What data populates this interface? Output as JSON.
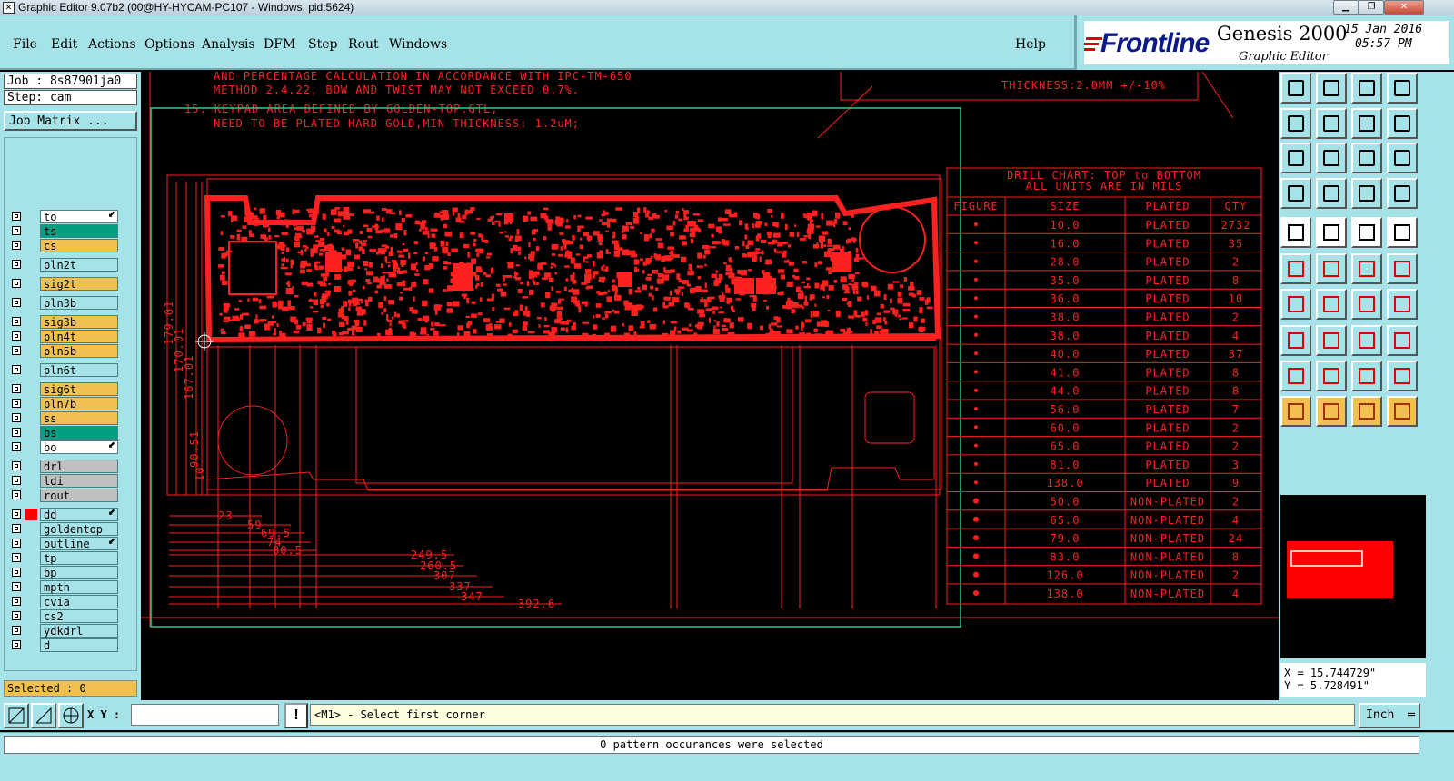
{
  "window": {
    "title": "Graphic Editor 9.07b2 (00@HY-HYCAM-PC107 - Windows, pid:5624)"
  },
  "menu": {
    "items": [
      {
        "label": "File",
        "name": "menu-file"
      },
      {
        "label": "Edit",
        "name": "menu-edit"
      },
      {
        "label": "Actions",
        "name": "menu-actions"
      },
      {
        "label": "Options",
        "name": "menu-options"
      },
      {
        "label": "Analysis",
        "name": "menu-analysis"
      },
      {
        "label": "DFM",
        "name": "menu-dfm"
      },
      {
        "label": "Step",
        "name": "menu-step"
      },
      {
        "label": "Rout",
        "name": "menu-rout"
      },
      {
        "label": "Windows",
        "name": "menu-windows"
      }
    ],
    "help": "Help"
  },
  "logo": {
    "brand": "Frontline",
    "product": "Genesis 2000",
    "subtitle": "Graphic Editor",
    "date": "15 Jan 2016",
    "time": "05:57 PM"
  },
  "job": {
    "job_label": "Job : 8s87901ja0",
    "step_label": "Step: cam",
    "matrix_button": "Job Matrix ..."
  },
  "layers": [
    {
      "name": "to",
      "color": "#ffffff",
      "arrow": true
    },
    {
      "name": "ts",
      "color": "#00a080"
    },
    {
      "name": "cs",
      "color": "#f0c050"
    },
    {
      "name": "pln2t",
      "color": "#a6e3e8",
      "gap": true
    },
    {
      "name": "sig2t",
      "color": "#f0c050",
      "gap": true
    },
    {
      "name": "pln3b",
      "color": "#a6e3e8",
      "gap": true
    },
    {
      "name": "sig3b",
      "color": "#f0c050",
      "gap": true
    },
    {
      "name": "pln4t",
      "color": "#f0c050"
    },
    {
      "name": "pln5b",
      "color": "#f0c050"
    },
    {
      "name": "pln6t",
      "color": "#a6e3e8",
      "gap": true
    },
    {
      "name": "sig6t",
      "color": "#f0c050",
      "gap": true
    },
    {
      "name": "pln7b",
      "color": "#f0c050"
    },
    {
      "name": "ss",
      "color": "#f0c050"
    },
    {
      "name": "bs",
      "color": "#00a080"
    },
    {
      "name": "bo",
      "color": "#ffffff",
      "arrow": true
    },
    {
      "name": "drl",
      "color": "#c0c0c0",
      "gap": true
    },
    {
      "name": "ldi",
      "color": "#c0c0c0"
    },
    {
      "name": "rout",
      "color": "#c0c0c0"
    },
    {
      "name": "dd",
      "color": "#a6e3e8",
      "gap": true,
      "active": true,
      "arrow": true
    },
    {
      "name": "goldentop",
      "color": "#a6e3e8"
    },
    {
      "name": "outline",
      "color": "#a6e3e8",
      "arrow": true
    },
    {
      "name": "tp",
      "color": "#a6e3e8"
    },
    {
      "name": "bp",
      "color": "#a6e3e8"
    },
    {
      "name": "mpth",
      "color": "#a6e3e8"
    },
    {
      "name": "cvia",
      "color": "#a6e3e8"
    },
    {
      "name": "cs2",
      "color": "#a6e3e8"
    },
    {
      "name": "ydkdrl",
      "color": "#a6e3e8"
    },
    {
      "name": "d",
      "color": "#a6e3e8"
    }
  ],
  "selected_label": "Selected : 0",
  "notes": {
    "line1": "AND PERCENTAGE CALCULATION IN ACCORDANCE WITH IPC-TM-650",
    "line2": "METHOD 2.4.22, BOW AND TWIST MAY NOT EXCEED 0.7%.",
    "line3": "15. KEYPAD AREA DEFINED BY GOLDEN-TOP.GTL,",
    "line4": "NEED TO BE PLATED HARD GOLD,MIN THICKNESS: 1.2uM;",
    "thickness": "THICKNESS:2.0MM +/-10%"
  },
  "drill_chart": {
    "title1": "DRILL CHART: TOP to BOTTOM",
    "title2": "ALL UNITS ARE IN MILS",
    "headers": [
      "FIGURE",
      "SIZE",
      "PLATED",
      "QTY"
    ],
    "rows": [
      [
        "10.0",
        "PLATED",
        "2732"
      ],
      [
        "16.0",
        "PLATED",
        "35"
      ],
      [
        "28.0",
        "PLATED",
        "2"
      ],
      [
        "35.0",
        "PLATED",
        "8"
      ],
      [
        "36.0",
        "PLATED",
        "10"
      ],
      [
        "38.0",
        "PLATED",
        "2"
      ],
      [
        "38.0",
        "PLATED",
        "4"
      ],
      [
        "40.0",
        "PLATED",
        "37"
      ],
      [
        "41.0",
        "PLATED",
        "8"
      ],
      [
        "44.0",
        "PLATED",
        "8"
      ],
      [
        "56.0",
        "PLATED",
        "7"
      ],
      [
        "60.0",
        "PLATED",
        "2"
      ],
      [
        "65.0",
        "PLATED",
        "2"
      ],
      [
        "81.0",
        "PLATED",
        "3"
      ],
      [
        "138.0",
        "PLATED",
        "9"
      ],
      [
        "50.0",
        "NON-PLATED",
        "2"
      ],
      [
        "65.0",
        "NON-PLATED",
        "4"
      ],
      [
        "79.0",
        "NON-PLATED",
        "24"
      ],
      [
        "83.0",
        "NON-PLATED",
        "8"
      ],
      [
        "126.0",
        "NON-PLATED",
        "2"
      ],
      [
        "138.0",
        "NON-PLATED",
        "4"
      ]
    ]
  },
  "dimensions": {
    "vertical": [
      "179.01",
      "170.01",
      "167.01",
      "90.51",
      "10"
    ],
    "horizontal": [
      "23",
      "59",
      "69.5",
      "74",
      "80.5",
      "249.5",
      "260.5",
      "307",
      "337",
      "347",
      "392.6"
    ]
  },
  "coords": {
    "x": "X = 15.744729\"",
    "y": "Y = 5.728491\""
  },
  "status": {
    "xy_label": "X Y :",
    "xy_value": "",
    "prompt": "<M1> - Select first corner",
    "units": "Inch"
  },
  "message": "0 pattern occurances were selected",
  "colors": {
    "panel": "#a6e3e8",
    "copper": "#ff0000",
    "profile": "#00c080",
    "highlight": "#f0c050"
  }
}
